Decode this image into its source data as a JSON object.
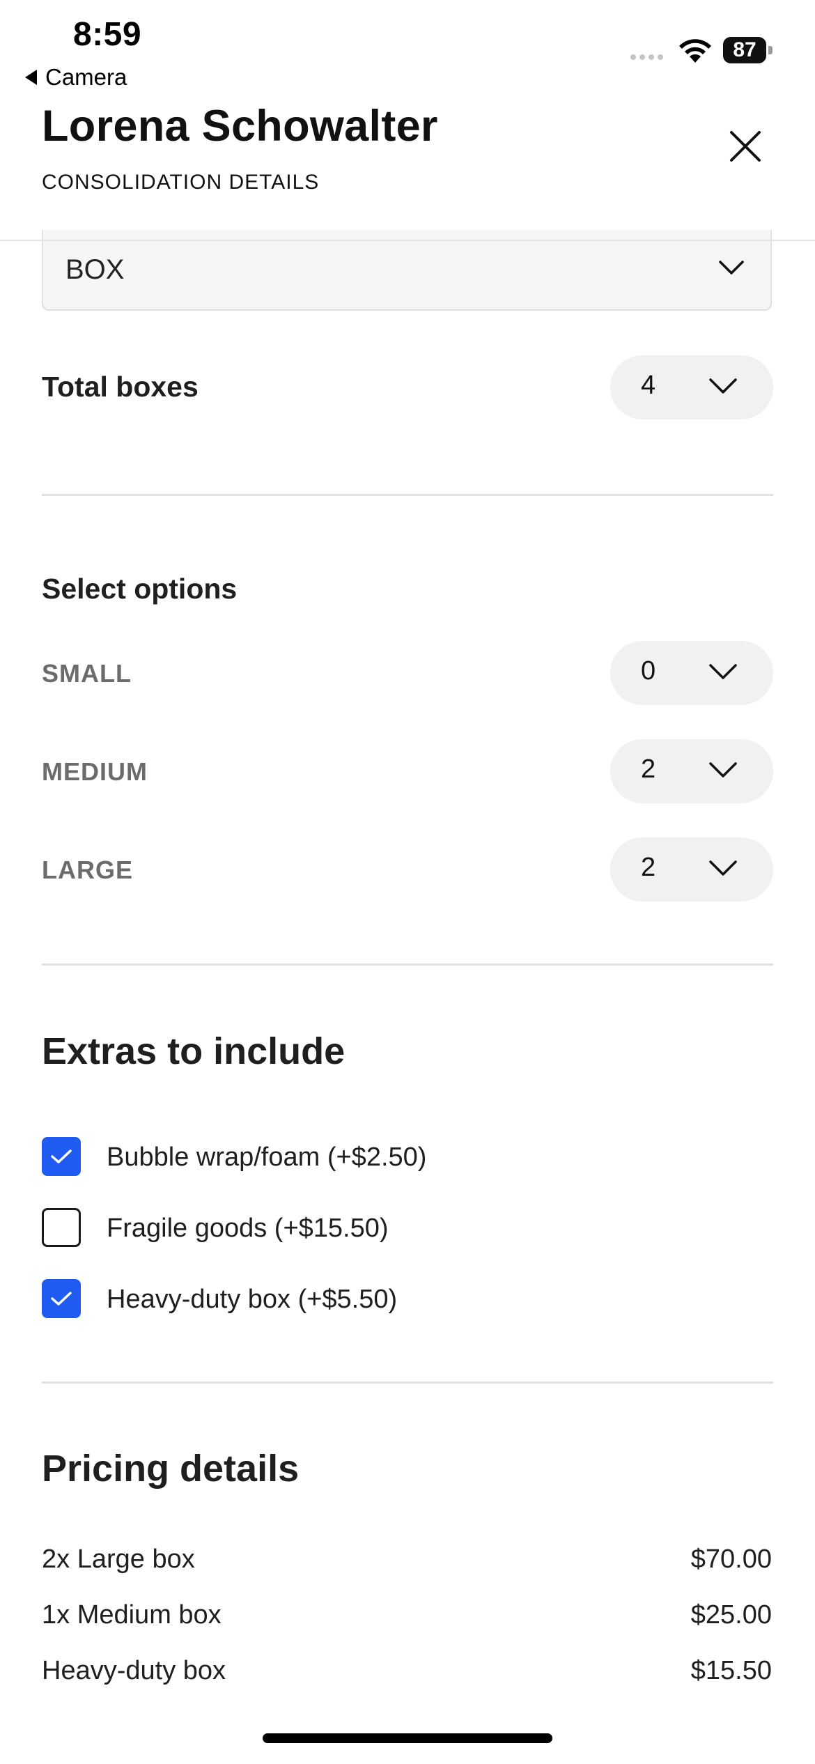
{
  "status_bar": {
    "time": "8:59",
    "back_label": "Camera",
    "battery": "87"
  },
  "header": {
    "title": "Lorena Schowalter",
    "subtitle": "CONSOLIDATION DETAILS",
    "close_icon": "close-icon"
  },
  "box_type": {
    "selected": "BOX"
  },
  "total_boxes": {
    "label": "Total boxes",
    "value": "4"
  },
  "select_options": {
    "heading": "Select options",
    "items": [
      {
        "label": "SMALL",
        "value": "0"
      },
      {
        "label": "MEDIUM",
        "value": "2"
      },
      {
        "label": "LARGE",
        "value": "2"
      }
    ]
  },
  "extras": {
    "heading": "Extras to include",
    "items": [
      {
        "label": "Bubble wrap/foam (+$2.50)",
        "checked": true
      },
      {
        "label": "Fragile goods (+$15.50)",
        "checked": false
      },
      {
        "label": "Heavy-duty box (+$5.50)",
        "checked": true
      }
    ]
  },
  "pricing": {
    "heading": "Pricing details",
    "lines": [
      {
        "label": "2x Large box",
        "amount": "$70.00"
      },
      {
        "label": "1x Medium box",
        "amount": "$25.00"
      },
      {
        "label": "Heavy-duty box",
        "amount": "$15.50"
      }
    ]
  },
  "colors": {
    "accent": "#1f5bf1",
    "pill_bg": "#f1f1f1",
    "divider": "#e2e2e2"
  }
}
